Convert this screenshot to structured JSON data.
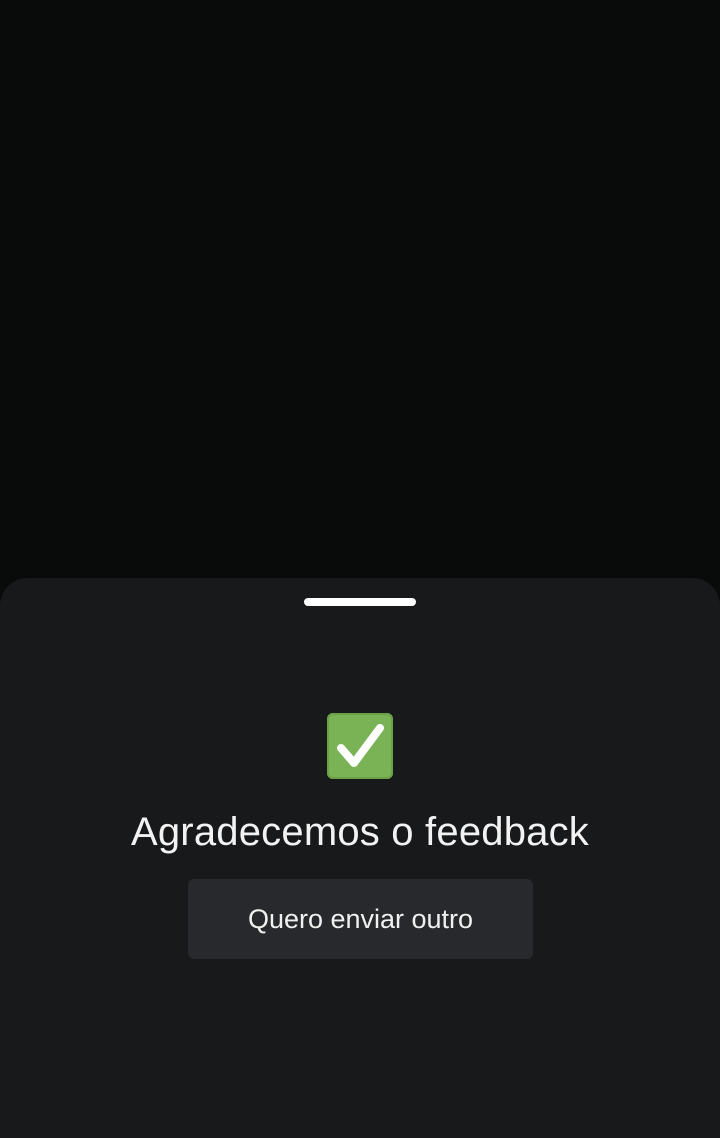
{
  "sheet": {
    "title": "Agradecemos o feedback",
    "button_label": "Quero enviar outro",
    "icon": "check-mark-button-icon"
  },
  "colors": {
    "backdrop": "#090b0b",
    "sheet_background": "#18191b",
    "button_background": "#28292c",
    "check_green": "#7ab356",
    "text": "#f2f2f2"
  }
}
